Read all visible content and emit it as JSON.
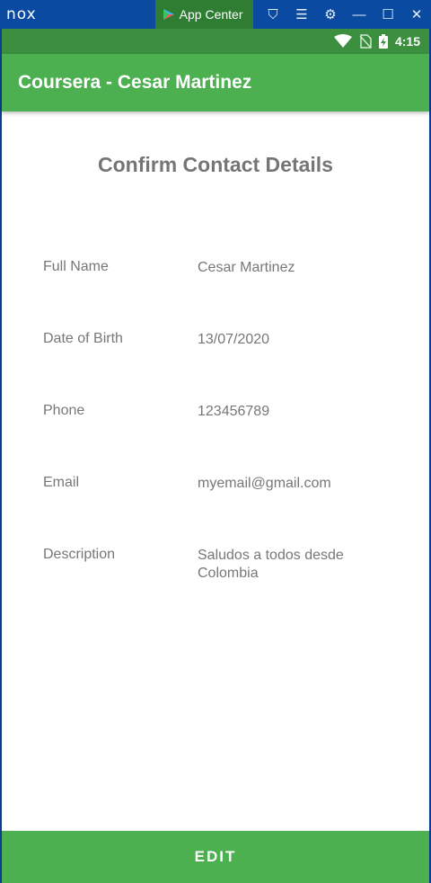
{
  "emulator": {
    "logo": "nox",
    "app_center_label": "App Center",
    "controls": [
      "shirt-icon",
      "menu-icon",
      "gear-icon",
      "minimize-icon",
      "maximize-icon",
      "close-icon"
    ]
  },
  "status_bar": {
    "time": "4:15"
  },
  "app_bar": {
    "title": "Coursera - Cesar Martinez"
  },
  "page": {
    "title": "Confirm Contact Details",
    "fields": [
      {
        "label": "Full Name",
        "value": "Cesar Martinez"
      },
      {
        "label": "Date of Birth",
        "value": "13/07/2020"
      },
      {
        "label": "Phone",
        "value": "123456789"
      },
      {
        "label": "Email",
        "value": "myemail@gmail.com"
      },
      {
        "label": "Description",
        "value": "Saludos a todos desde Colombia"
      }
    ]
  },
  "actions": {
    "edit_label": "EDIT"
  },
  "colors": {
    "primary": "#4caf50",
    "primary_dark": "#3b8f3f",
    "emulator": "#0a4aa0"
  }
}
